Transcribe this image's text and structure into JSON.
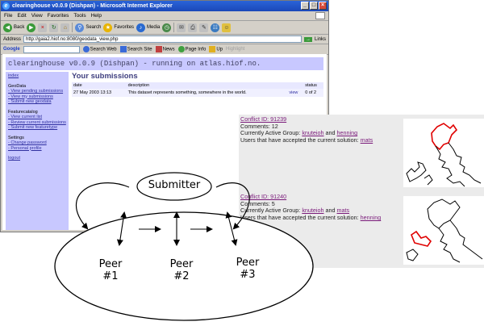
{
  "browser": {
    "title": "clearinghouse v0.0.9 (Dishpan) - Microsoft Internet Explorer",
    "menu": [
      "File",
      "Edit",
      "View",
      "Favorites",
      "Tools",
      "Help"
    ],
    "toolbar": {
      "back": "Back",
      "search": "Search",
      "favorites": "Favorites",
      "media": "Media"
    },
    "address_label": "Address",
    "url": "http://gaia2.hiof.no:8080/geodata_view.php",
    "links_label": "Links",
    "google_label": "Google",
    "google_bar": [
      "Search Web",
      "Search Site",
      "News",
      "Page Info",
      "Up",
      "Highlight"
    ]
  },
  "site": {
    "header": "clearinghouse v0.0.9 (Dishpan) - running on atlas.hiof.no.",
    "sidebar": {
      "index": "index",
      "geodata_title": "GeoData",
      "geodata_items": [
        "- View pending submissions",
        "- View my submissions",
        "- Submit new geodata"
      ],
      "fc_title": "Featurecatalog",
      "fc_items": [
        "- View current list",
        "- Review current submissions",
        "- Submit new featuretype"
      ],
      "settings_title": "Settings",
      "settings_items": [
        "- Change password",
        "- Personal profile"
      ],
      "logout": "logout"
    },
    "submissions": {
      "heading": "Your submissions",
      "columns": [
        "date",
        "description",
        "",
        "status"
      ],
      "row": {
        "date": "27 May 2003 13:13",
        "description": "This dataset represents something, somewhere in the world.",
        "action": "view",
        "status": "0 of 2"
      }
    }
  },
  "conflicts": [
    {
      "id_label": "Conflict ID: 91239",
      "comments": "Comments: 12",
      "group_prefix": "Currently Active Group:",
      "group_a": "knuteioh",
      "and": "and",
      "group_b": "henning",
      "accepted_prefix": "Users that have accepted the current solution:",
      "accepted": "mats"
    },
    {
      "id_label": "Conflict ID: 91240",
      "comments": "Comments: 5",
      "group_prefix": "Currently Active Group:",
      "group_a": "knuteioh",
      "and": "and",
      "group_b": "mats",
      "accepted_prefix": "Users that have accepted the current solution:",
      "accepted": "henning"
    }
  ],
  "diagram": {
    "submitter": "Submitter",
    "peers": [
      {
        "name": "Peer",
        "num": "#1"
      },
      {
        "name": "Peer",
        "num": "#2"
      },
      {
        "name": "Peer",
        "num": "#3"
      }
    ]
  },
  "colors": {
    "title_bar": "#1b48b8",
    "site_panel": "#c8c8ff",
    "link": "#7a1a7a",
    "conflict_line": "#e00000"
  }
}
